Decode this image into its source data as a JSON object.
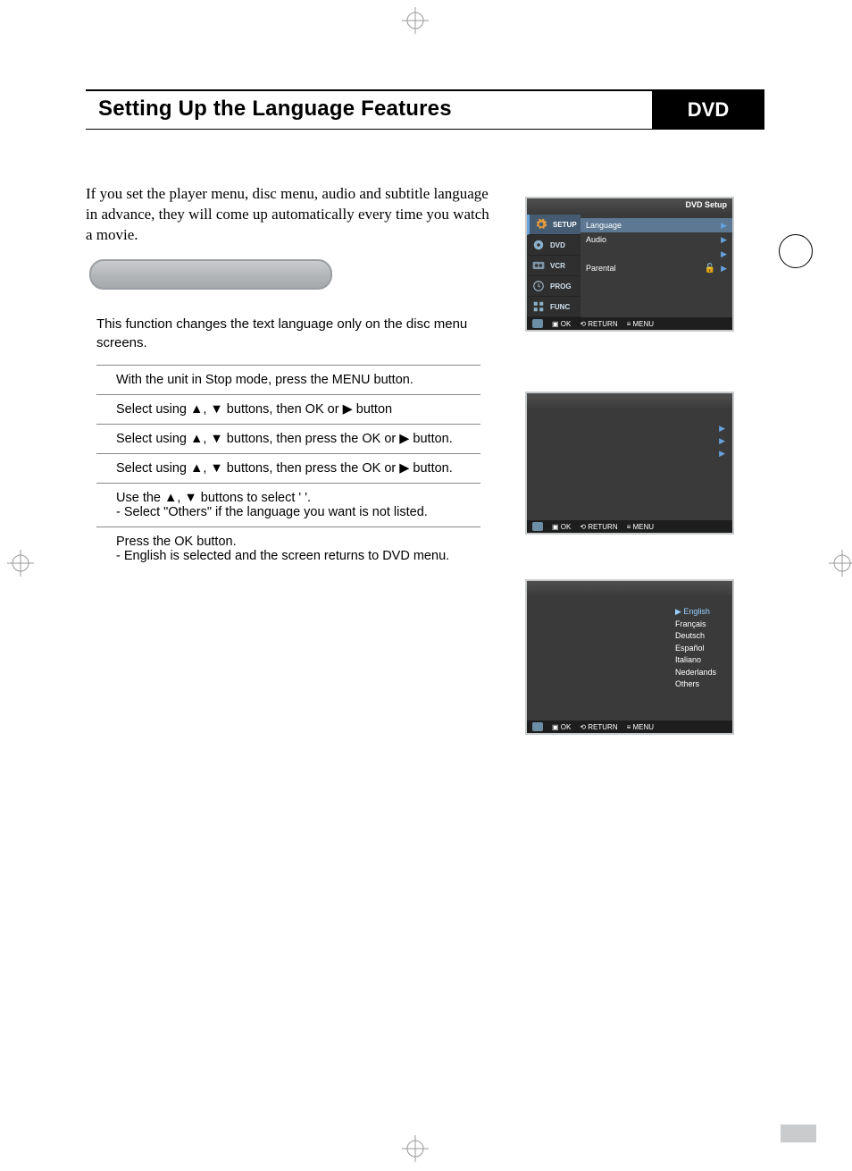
{
  "header": {
    "title": "Setting Up the Language Features",
    "badge": "DVD"
  },
  "intro": "If you set the player menu, disc menu, audio and subtitle language in advance, they will come up automatically every time you watch a movie.",
  "func_desc": "This function changes the text language only on the disc menu screens.",
  "steps": [
    "With the unit in Stop mode, press the MENU button.",
    "Select          using ▲, ▼ buttons, then OK or ▶  button",
    "Select                             using ▲, ▼ buttons, then press the OK or ▶ button.",
    "Select                     using ▲, ▼ buttons, then press the  OK or ▶ button.",
    "Use the ▲, ▼ buttons to select '             '.\n- Select \"Others\" if the language you want is not listed.",
    "Press the OK button.\n- English is selected and the screen returns to DVD menu."
  ],
  "osd1": {
    "title": "DVD Setup",
    "sidebar": [
      "SETUP",
      "DVD",
      "VCR",
      "PROG",
      "FUNC"
    ],
    "rows": [
      "Language",
      "Audio",
      "",
      "Parental"
    ],
    "bottombar": [
      "OK",
      "RETURN",
      "MENU"
    ]
  },
  "osd2": {
    "rows_right": [
      "▶",
      "▶",
      "▶"
    ],
    "bottombar": [
      "OK",
      "RETURN",
      "MENU"
    ]
  },
  "osd3": {
    "languages": [
      "English",
      "Français",
      "Deutsch",
      "Español",
      "Italiano",
      "Nederlands",
      "Others"
    ],
    "selected_prefix": "▶",
    "bottombar": [
      "OK",
      "RETURN",
      "MENU"
    ]
  }
}
